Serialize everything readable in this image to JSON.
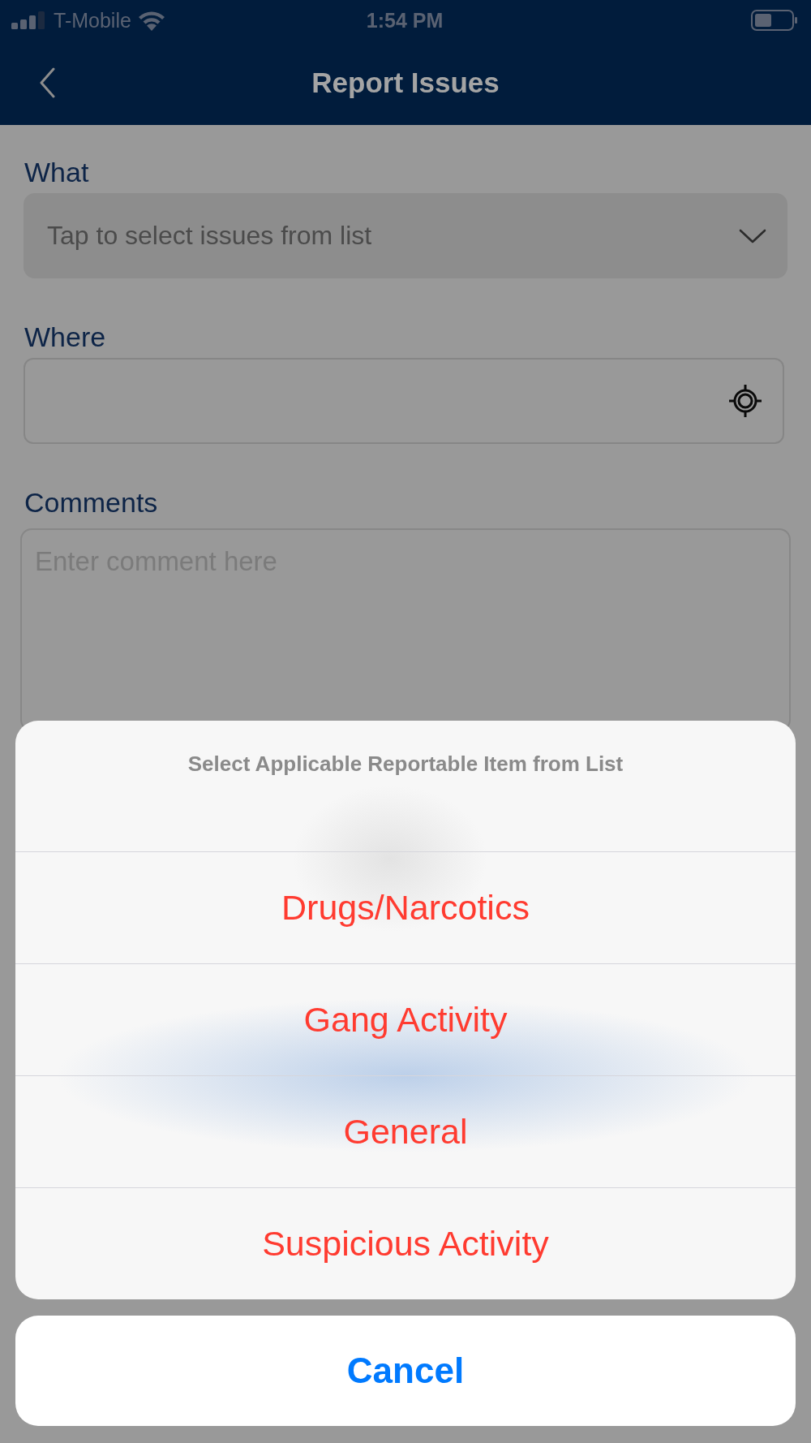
{
  "status_bar": {
    "carrier": "T-Mobile",
    "time": "1:54 PM"
  },
  "header": {
    "title": "Report Issues"
  },
  "form": {
    "fields": [
      {
        "kind": "select",
        "label": "What",
        "placeholder": "Tap to select issues from list"
      },
      {
        "kind": "location",
        "label": "Where"
      },
      {
        "kind": "textarea",
        "label": "Comments",
        "placeholder": "Enter comment here"
      }
    ]
  },
  "action_sheet": {
    "title": "Select Applicable Reportable Item from List",
    "options": [
      "Drugs/Narcotics",
      "Gang Activity",
      "General",
      "Suspicious Activity"
    ],
    "cancel": "Cancel"
  }
}
